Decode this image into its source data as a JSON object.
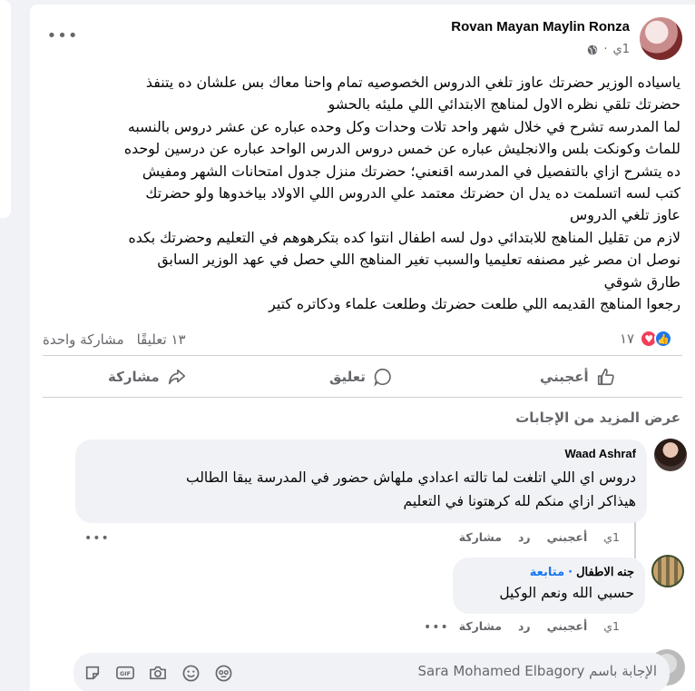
{
  "post": {
    "author": "Rovan Mayan Maylin Ronza",
    "time": "1ي",
    "privacy_icon": "globe-icon",
    "text_lines": [
      "ياسياده الوزير حضرتك عاوز تلغي الدروس الخصوصيه تمام واحنا معاك بس علشان ده يتنفذ",
      "حضرتك تلقي نظره الاول لمناهج الابتدائي اللي مليئه بالحشو",
      "لما المدرسه تشرح في خلال شهر واحد تلات وحدات وكل وحده عباره عن عشر دروس بالنسبه",
      "للماث وكونكت بلس والانجليش عباره عن خمس دروس الدرس الواحد عباره عن درسين لوحده",
      "ده يتشرح ازاي بالتفصيل  في المدرسه اقنعني؛ حضرتك منزل جدول امتحانات الشهر ومفيش",
      "كتب لسه اتسلمت ده يدل ان حضرتك معتمد علي الدروس اللي الاولاد بياخدوها ولو حضرتك",
      "عاوز تلغي الدروس",
      "لازم من تقليل المناهج للابتدائي دول لسه اطفال انتوا كده بتكرهوهم في التعليم وحضرتك بكده",
      "نوصل ان مصر غير مصنفه تعليميا والسبب تغير المناهج اللي حصل في عهد الوزير السابق",
      "طارق شوقي",
      "رجعوا المناهج القديمه اللي طلعت حضرتك وطلعت علماء ودكاتره كتير"
    ],
    "reaction_count": "١٧",
    "comments_count": "١٣ تعليقًا",
    "shares_count": "مشاركة واحدة"
  },
  "actions": {
    "like": "أعجبني",
    "comment": "تعليق",
    "share": "مشاركة"
  },
  "more_replies": "عرض المزيد من الإجابات",
  "replies": [
    {
      "name": "Waad Ashraf",
      "lines": [
        "دروس اي اللي اتلغت لما تالته اعدادي ملهاش حضور في المدرسة يبقا الطالب",
        "هيذاكر ازاي منكم لله كرهتونا في التعليم"
      ],
      "time": "1ي",
      "like": "أعجبني",
      "reply": "رد",
      "share": "مشاركة"
    },
    {
      "name": "جنه الاطفال",
      "follow": "متابعة",
      "separator": "·",
      "lines": [
        "حسبي الله ونعم الوكيل"
      ],
      "time": "1ي",
      "like": "أعجبني",
      "reply": "رد",
      "share": "مشاركة"
    }
  ],
  "composer": {
    "placeholder": "الإجابة باسم Sara Mohamed Elbagory"
  },
  "colors": {
    "accent": "#1877f2",
    "muted": "#65676b",
    "love": "#f33e58"
  }
}
